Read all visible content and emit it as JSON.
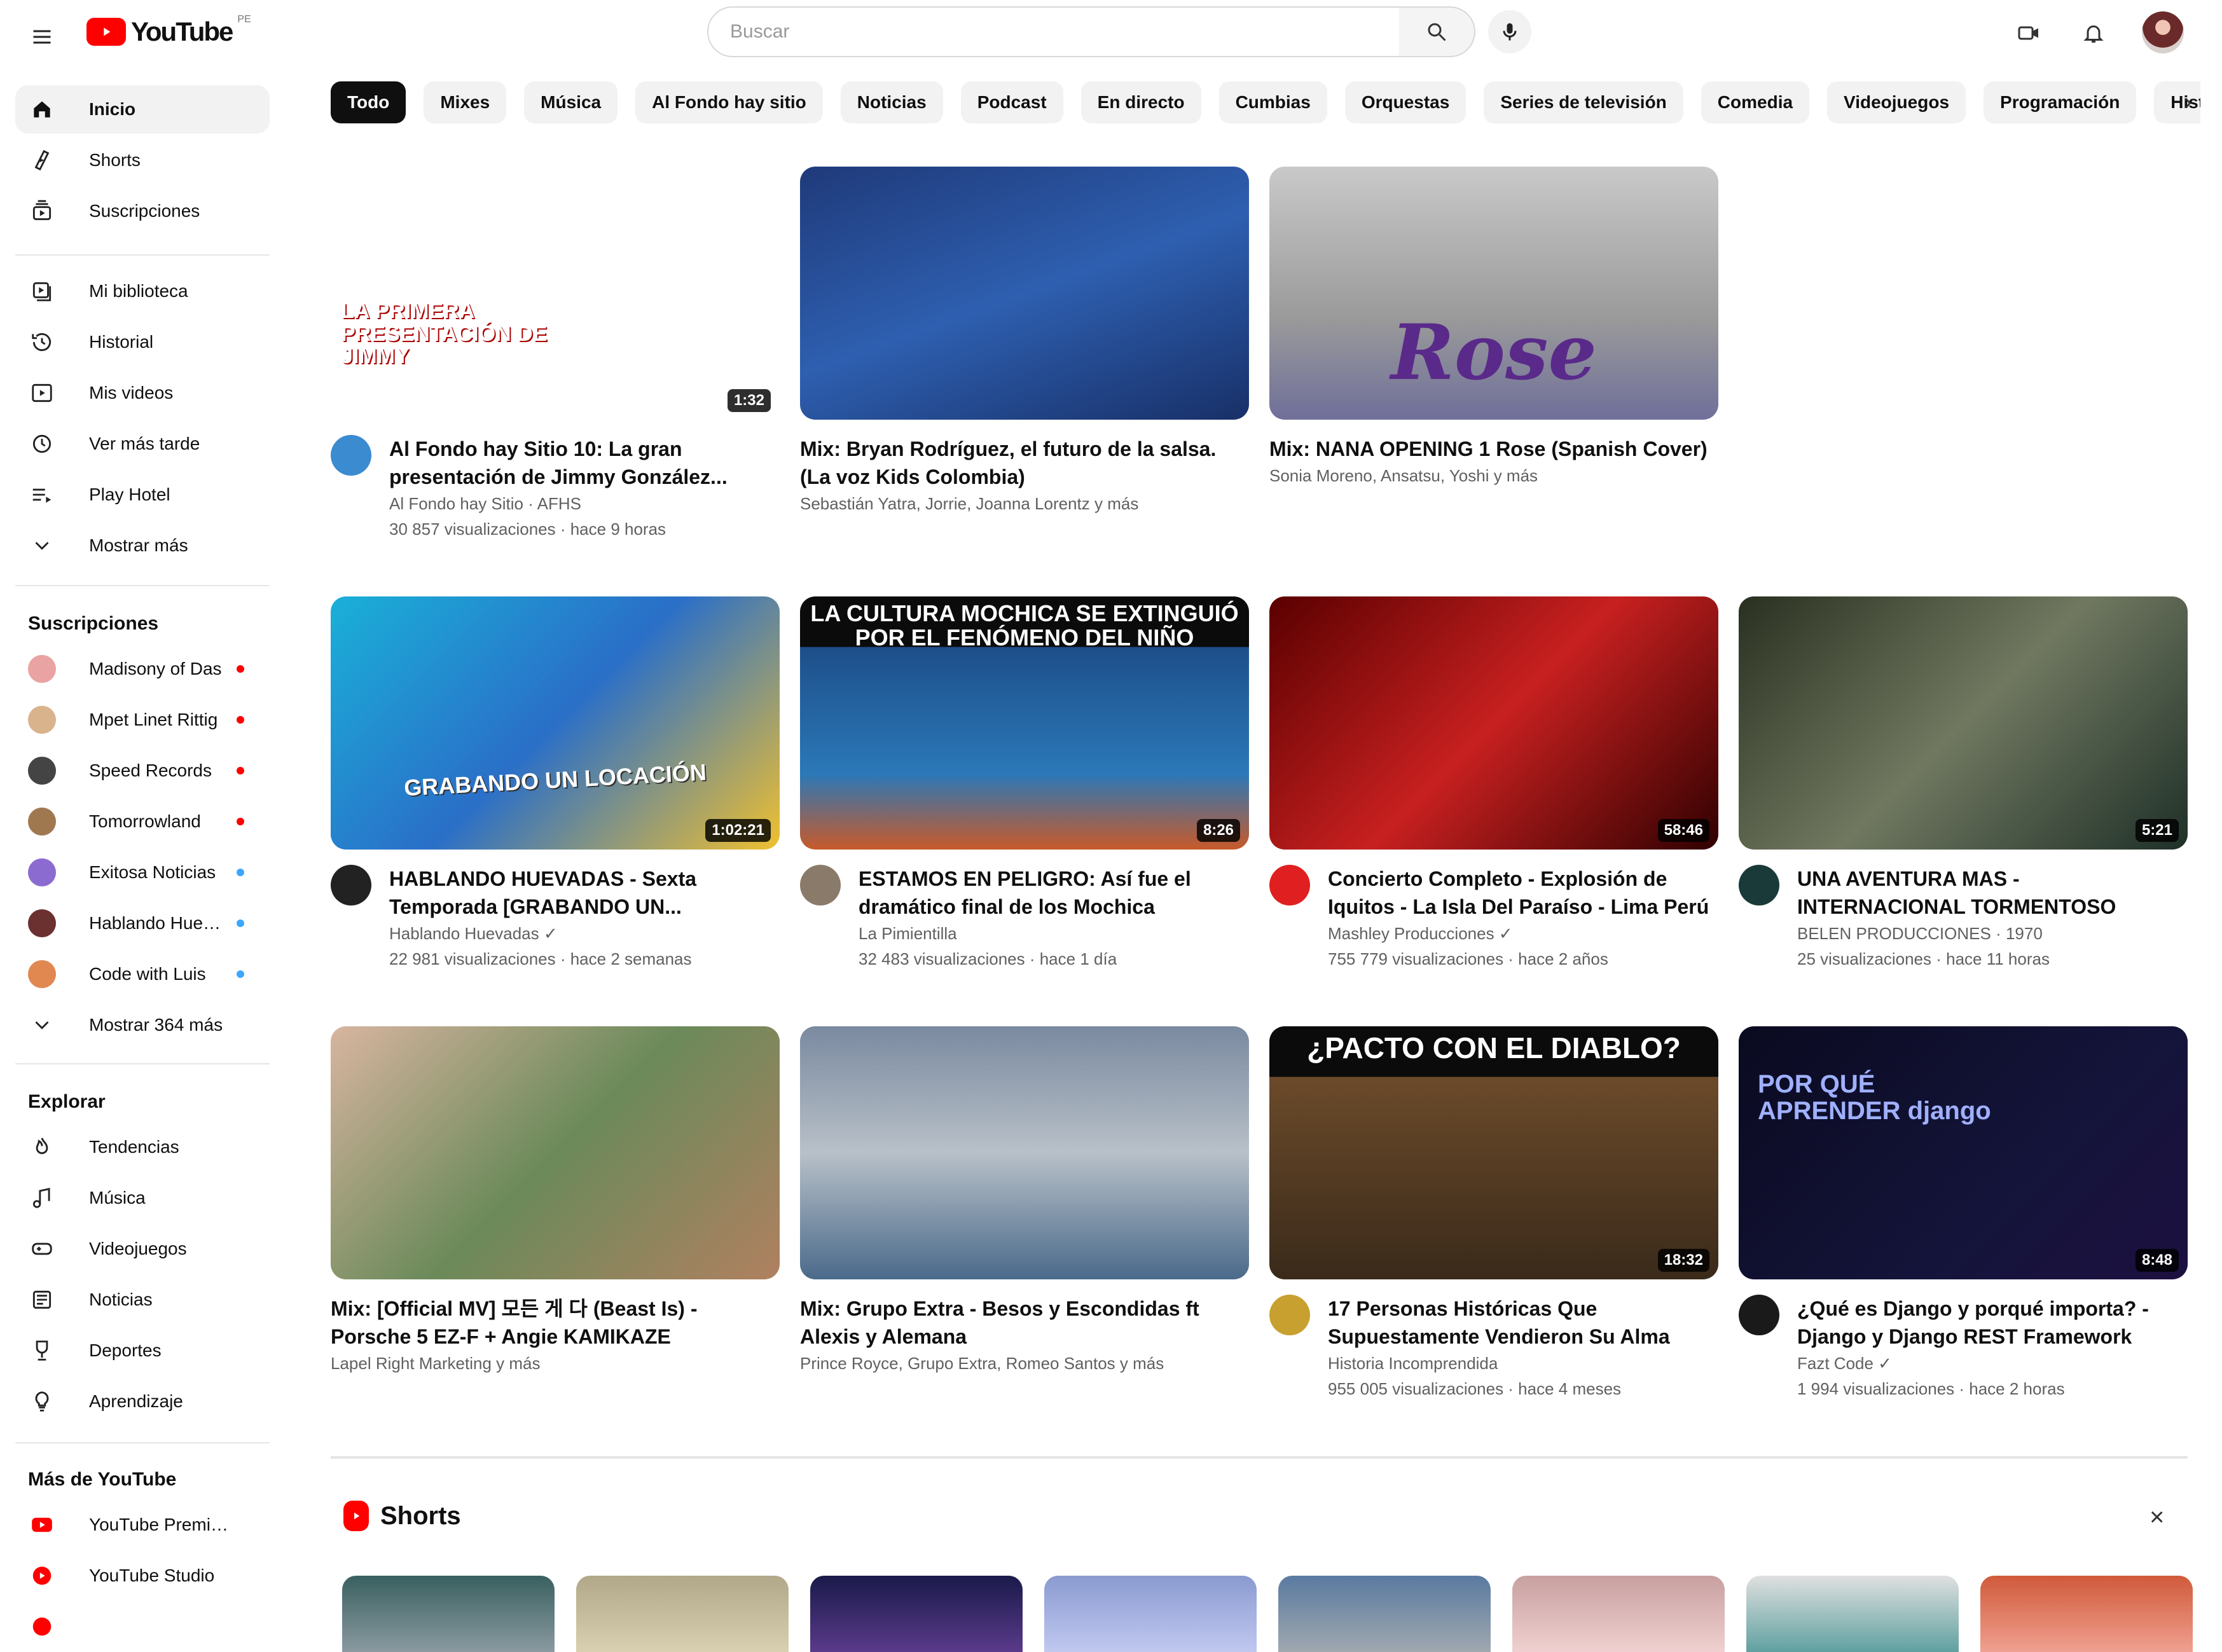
{
  "header": {
    "logo_text": "YouTube",
    "logo_region": "PE",
    "search_placeholder": "Buscar"
  },
  "sidebar": {
    "main": [
      {
        "label": "Inicio",
        "icon": "home-icon",
        "active": true
      },
      {
        "label": "Shorts",
        "icon": "shorts-icon"
      },
      {
        "label": "Suscripciones",
        "icon": "subscriptions-icon"
      }
    ],
    "library": [
      {
        "label": "Mi biblioteca",
        "icon": "library-icon"
      },
      {
        "label": "Historial",
        "icon": "history-icon"
      },
      {
        "label": "Mis videos",
        "icon": "your-videos-icon"
      },
      {
        "label": "Ver más tarde",
        "icon": "watch-later-icon"
      },
      {
        "label": "Play Hotel",
        "icon": "playlist-icon"
      },
      {
        "label": "Mostrar más",
        "icon": "chevron-down-icon"
      }
    ],
    "subscriptions_heading": "Suscripciones",
    "subscriptions": [
      {
        "label": "Madisony of Das",
        "dot": "#ff0000",
        "avatar": "#e9a3a3"
      },
      {
        "label": "Mpet Linet Rittig",
        "dot": "#ff0000",
        "avatar": "#d9b38c"
      },
      {
        "label": "Speed Records",
        "dot": "#ff0000",
        "avatar": "#444444"
      },
      {
        "label": "Tomorrowland",
        "dot": "#ff0000",
        "avatar": "#a07850"
      },
      {
        "label": "Exitosa Noticias",
        "dot": "#3ea6ff",
        "avatar": "#8c6bd1"
      },
      {
        "label": "Hablando Huevadas",
        "dot": "#3ea6ff",
        "avatar": "#6b3030"
      },
      {
        "label": "Code with Luis",
        "dot": "#3ea6ff",
        "avatar": "#e08850"
      },
      {
        "label": "Mostrar 364 más",
        "icon": "chevron-down-icon"
      }
    ],
    "explore_heading": "Explorar",
    "explore": [
      {
        "label": "Tendencias",
        "icon": "trending-icon"
      },
      {
        "label": "Música",
        "icon": "music-icon"
      },
      {
        "label": "Videojuegos",
        "icon": "gaming-icon"
      },
      {
        "label": "Noticias",
        "icon": "news-icon"
      },
      {
        "label": "Deportes",
        "icon": "sports-icon"
      },
      {
        "label": "Aprendizaje",
        "icon": "learning-icon"
      }
    ],
    "more_heading": "Más de YouTube",
    "more": [
      {
        "label": "YouTube Premium",
        "icon": "youtube-premium-icon"
      },
      {
        "label": "YouTube Studio",
        "icon": "youtube-studio-icon"
      }
    ]
  },
  "chips": [
    "Todo",
    "Mixes",
    "Música",
    "Al Fondo hay sitio",
    "Noticias",
    "Podcast",
    "En directo",
    "Cumbias",
    "Orquestas",
    "Series de televisión",
    "Comedia",
    "Videojuegos",
    "Programación",
    "Historia"
  ],
  "videos": [
    {
      "title": "Al Fondo hay Sitio 10: La gran presentación de Jimmy González...",
      "channel": "Al Fondo hay Sitio · AFHS",
      "stats": "30 857 visualizaciones · hace 9 horas",
      "duration": "1:32",
      "overlay": "LA PRIMERA PRESENTACIÓN DE JIMMY",
      "bg": "linear-gradient(135deg,#ff7a2e,#ff4f3a 60,#ff8a1f)",
      "avatar": "#3a8bd0"
    },
    {
      "title": "Mix: Bryan Rodríguez, el futuro de la salsa. (La voz Kids Colombia)",
      "channel": "Sebastián Yatra, Jorrie, Joanna Lorentz y más",
      "stats": "",
      "duration": "",
      "overlay": "",
      "bg": "linear-gradient(160deg,#1f3a7a,#2e5fb0 50%,#183068)",
      "avatar": ""
    },
    {
      "title": "Mix: NANA OPENING 1 Rose (Spanish Cover)",
      "channel": "Sonia Moreno, Ansatsu, Yoshi y más",
      "stats": "",
      "duration": "",
      "overlay": "Rose",
      "bg": "linear-gradient(180deg,#c9c9c9,#9a9a9a 60%,#6f6f9a)",
      "avatar": ""
    },
    {
      "title": "HABLANDO HUEVADAS - Sexta Temporada [GRABANDO UN...",
      "channel": "Hablando Huevadas ✓",
      "stats": "22 981 visualizaciones · hace 2 semanas",
      "duration": "1:02:21",
      "overlay": "GRABANDO UN LOCACIÓN",
      "bg": "linear-gradient(135deg,#1ab0d8,#2a6fc8 50%,#f0c030)",
      "avatar": "#222222"
    },
    {
      "title": "ESTAMOS EN PELIGRO: Así fue el dramático final de los Mochica",
      "channel": "La Pimientilla",
      "stats": "32 483 visualizaciones · hace 1 día",
      "duration": "8:26",
      "overlay": "LA CULTURA MOCHICA SE EXTINGUIÓ POR EL FENÓMENO DEL NIÑO",
      "bg": "linear-gradient(180deg,#0b0b0b 0 20%,#1d4f8a 20%,#2b78b8 70%,#c85a2a)",
      "avatar": "#8a7a6a"
    },
    {
      "title": "Concierto Completo - Explosión de Iquitos - La Isla Del Paraíso - Lima Perú",
      "channel": "Mashley Producciones ✓",
      "stats": "755 779 visualizaciones · hace 2 años",
      "duration": "58:46",
      "overlay": "",
      "bg": "linear-gradient(135deg,#5a0000,#c82020 50%,#300000)",
      "avatar": "#e02020"
    },
    {
      "title": "UNA AVENTURA MAS - INTERNACIONAL TORMENTOSO",
      "channel": "BELEN PRODUCCIONES · 1970",
      "stats": "25 visualizaciones · hace 11 horas",
      "duration": "5:21",
      "overlay": "",
      "bg": "linear-gradient(135deg,#2a3020,#707860 50%,#1f3028)",
      "avatar": "#1a3a3a"
    },
    {
      "title": "Mix: [Official MV] 모든 게 다 (Beast Is) - Porsche 5 EZ-F + Angie KAMIKAZE",
      "channel": "Lapel Right Marketing y más",
      "stats": "",
      "duration": "",
      "overlay": "",
      "bg": "linear-gradient(135deg,#d8b5a0,#6b8a5a 50%,#b08060)",
      "avatar": ""
    },
    {
      "title": "Mix: Grupo Extra - Besos y Escondidas ft Alexis y Alemana",
      "channel": "Prince Royce, Grupo Extra, Romeo Santos y más",
      "stats": "",
      "duration": "",
      "overlay": "",
      "bg": "linear-gradient(180deg,#7a8aa0,#b8c0c8 50%,#4a6a8a)",
      "avatar": ""
    },
    {
      "title": "17 Personas Históricas Que Supuestamente Vendieron Su Alma",
      "channel": "Historia Incomprendida",
      "stats": "955 005 visualizaciones · hace 4 meses",
      "duration": "18:32",
      "overlay": "¿PACTO CON EL DIABLO?",
      "bg": "linear-gradient(180deg,#0b0b0b 0 20%,#6b4a2a 20%,#3a2a1a)",
      "avatar": "#c8a030"
    },
    {
      "title": "¿Qué es Django y porqué importa? - Django y Django REST Framework",
      "channel": "Fazt Code ✓",
      "stats": "1 994 visualizaciones · hace 2 horas",
      "duration": "8:48",
      "overlay": "POR QUÉ APRENDER django",
      "bg": "linear-gradient(135deg,#0a0a20,#14143a 60%,#1c1040)",
      "avatar": "#1a1a1a"
    }
  ],
  "shorts": {
    "title": "Shorts",
    "items": [
      {
        "bg": "linear-gradient(180deg,#3a6060,#8a9aa0)"
      },
      {
        "bg": "linear-gradient(180deg,#b0a888,#d8d0b0)"
      },
      {
        "bg": "linear-gradient(180deg,#1a1a4a,#5a3a8a)"
      },
      {
        "bg": "linear-gradient(180deg,#8a9ad0,#c0c8f0)"
      },
      {
        "bg": "linear-gradient(180deg,#5a7aa0,#a0a8b0)"
      },
      {
        "bg": "linear-gradient(180deg,#c8a0a0,#f0d0d0)"
      },
      {
        "bg": "linear-gradient(180deg,#e0e0e0,#60a0a0)"
      },
      {
        "bg": "linear-gradient(180deg,#d05a3a,#f0a090)"
      }
    ]
  }
}
